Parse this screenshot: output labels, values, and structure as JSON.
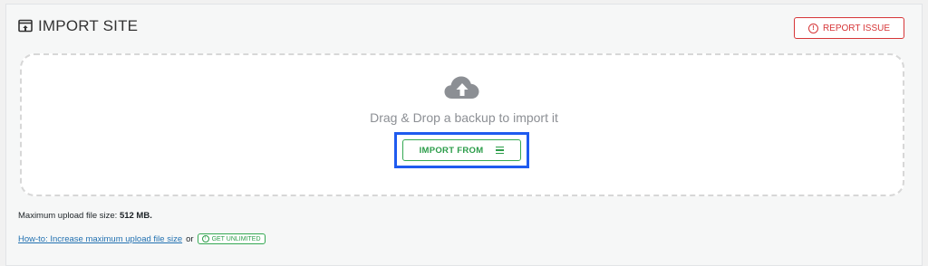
{
  "header": {
    "title": "IMPORT SITE",
    "icon": "import-site-icon",
    "report_label": "REPORT ISSUE",
    "report_icon": "alert-circle-icon"
  },
  "dropzone": {
    "icon": "cloud-upload-icon",
    "text": "Drag & Drop a backup to import it",
    "import_label": "IMPORT FROM",
    "import_icon": "hamburger-menu-icon"
  },
  "footer": {
    "max_upload_prefix": "Maximum upload file size:",
    "max_upload_value": "512 MB.",
    "howto_link": "How-to: Increase maximum upload file size",
    "or_text": "or",
    "unlimited_label": "GET UNLIMITED",
    "unlimited_icon": "alert-circle-icon"
  },
  "colors": {
    "danger": "#d63638",
    "success": "#2b9c49",
    "focus": "#1f5bef",
    "link": "#2271b1"
  }
}
